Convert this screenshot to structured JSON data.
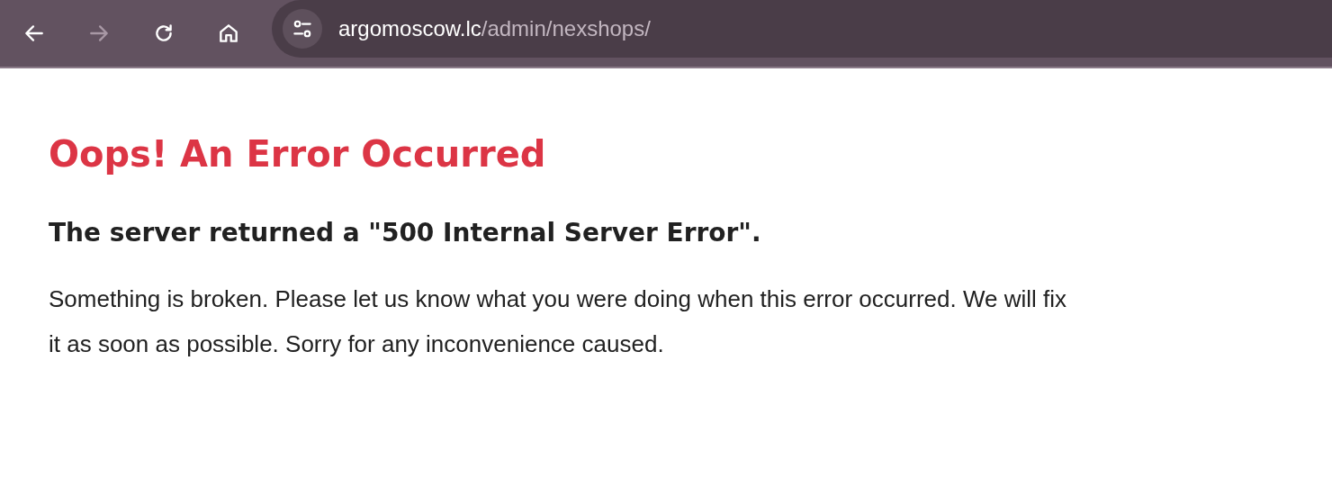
{
  "toolbar": {
    "back": {
      "disabled": false
    },
    "forward": {
      "disabled": true
    },
    "address": {
      "host": "argomoscow.lc",
      "path": "/admin/nexshops/"
    }
  },
  "page": {
    "heading": "Oops! An Error Occurred",
    "subheading": "The server returned a \"500 Internal Server Error\".",
    "message": "Something is broken. Please let us know what you were doing when this error occurred. We will fix it as soon as possible. Sorry for any inconvenience caused."
  }
}
